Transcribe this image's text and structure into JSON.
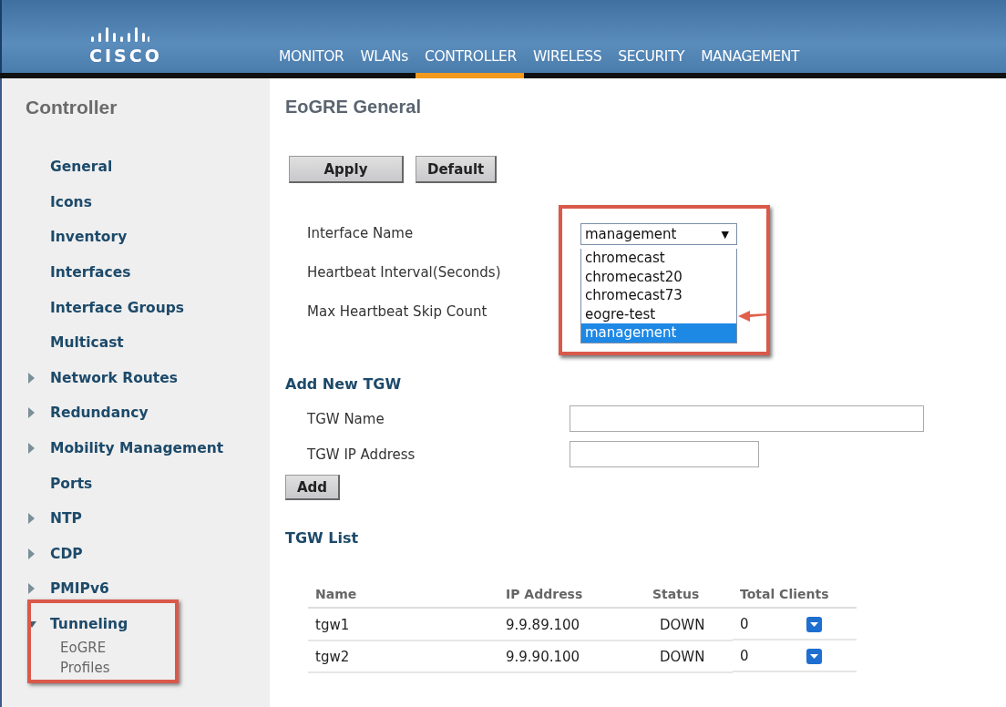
{
  "header": {
    "logo_text": "CISCO",
    "nav": [
      {
        "label": "MONITOR",
        "selected": false
      },
      {
        "label": "WLANs",
        "selected": false
      },
      {
        "label": "CONTROLLER",
        "selected": true
      },
      {
        "label": "WIRELESS",
        "selected": false
      },
      {
        "label": "SECURITY",
        "selected": false
      },
      {
        "label": "MANAGEMENT",
        "selected": false
      }
    ]
  },
  "sidebar": {
    "title": "Controller",
    "items": [
      {
        "label": "General",
        "expandable": false,
        "highlighted": false
      },
      {
        "label": "Icons",
        "expandable": false,
        "highlighted": false
      },
      {
        "label": "Inventory",
        "expandable": false,
        "highlighted": false
      },
      {
        "label": "Interfaces",
        "expandable": false,
        "highlighted": false
      },
      {
        "label": "Interface Groups",
        "expandable": false,
        "highlighted": false
      },
      {
        "label": "Multicast",
        "expandable": false,
        "highlighted": false
      },
      {
        "label": "Network Routes",
        "expandable": true,
        "expanded": false,
        "highlighted": false
      },
      {
        "label": "Redundancy",
        "expandable": true,
        "expanded": false,
        "highlighted": false
      },
      {
        "label": "Mobility Management",
        "expandable": true,
        "expanded": false,
        "highlighted": false
      },
      {
        "label": "Ports",
        "expandable": false,
        "highlighted": false
      },
      {
        "label": "NTP",
        "expandable": true,
        "expanded": false,
        "highlighted": false
      },
      {
        "label": "CDP",
        "expandable": true,
        "expanded": false,
        "highlighted": false
      },
      {
        "label": "PMIPv6",
        "expandable": true,
        "expanded": false,
        "highlighted": false
      },
      {
        "label": "Tunneling",
        "expandable": true,
        "expanded": true,
        "highlighted": true,
        "children": [
          {
            "label": "EoGRE"
          },
          {
            "label": "Profiles"
          }
        ]
      }
    ]
  },
  "content": {
    "title": "EoGRE General",
    "buttons": [
      "Apply",
      "Default"
    ],
    "general_fields": [
      {
        "label": "Interface Name",
        "kind": "dropdown"
      },
      {
        "label": "Heartbeat Interval(Seconds)",
        "kind": "blank"
      },
      {
        "label": "Max Heartbeat Skip Count",
        "kind": "blank"
      }
    ],
    "interface_dropdown": {
      "value": "management",
      "caret": "▼",
      "open": true,
      "highlighted": true,
      "options": [
        {
          "label": "chromecast",
          "selected": false,
          "arrow": false
        },
        {
          "label": "chromecast20",
          "selected": false,
          "arrow": false
        },
        {
          "label": "chromecast73",
          "selected": false,
          "arrow": false
        },
        {
          "label": "eogre-test",
          "selected": false,
          "arrow": true
        },
        {
          "label": "management",
          "selected": true,
          "arrow": false
        }
      ]
    },
    "add_section": {
      "title": "Add New TGW",
      "fields": [
        {
          "label": "TGW Name",
          "kind": "wide"
        },
        {
          "label": "TGW IP Address",
          "kind": "narrow"
        }
      ],
      "button": "Add"
    },
    "list_section": {
      "title": "TGW List",
      "columns": [
        "Name",
        "IP Address",
        "Status",
        "Total Clients"
      ],
      "rows": [
        {
          "name": "tgw1",
          "ip": "9.9.89.100",
          "status": "DOWN",
          "clients": "0"
        },
        {
          "name": "tgw2",
          "ip": "9.9.90.100",
          "status": "DOWN",
          "clients": "0"
        }
      ]
    }
  }
}
